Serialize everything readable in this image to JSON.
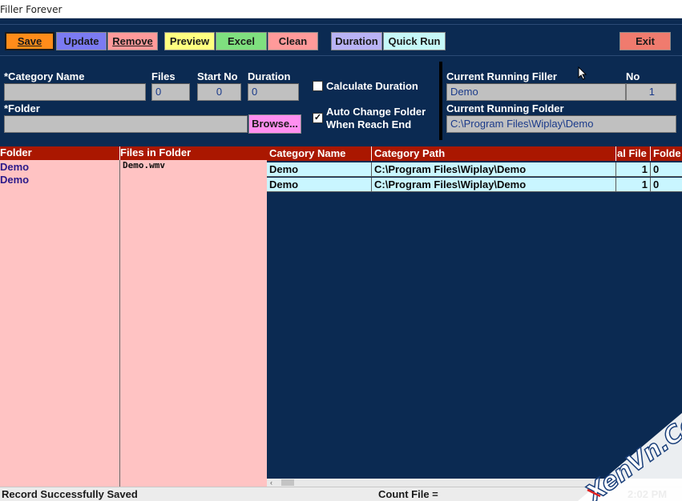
{
  "window": {
    "title": "Filler Forever"
  },
  "toolbar": {
    "save": {
      "label": "Save",
      "color": "#ff8c1a"
    },
    "update": {
      "label": "Update",
      "color": "#7b7bf2"
    },
    "remove": {
      "label": "Remove",
      "color": "#ff9a9a"
    },
    "preview": {
      "label": "Preview",
      "color": "#ffff80"
    },
    "excel": {
      "label": "Excel",
      "color": "#7fe07f"
    },
    "clean": {
      "label": "Clean",
      "color": "#ff9a9a"
    },
    "duration": {
      "label": "Duration",
      "color": "#b9b3f5"
    },
    "quick_run": {
      "label": "Quick Run",
      "color": "#c6f8f8"
    },
    "exit": {
      "label": "Exit",
      "color": "#f07b6e"
    }
  },
  "form": {
    "category_name_label": "*Category Name",
    "category_name_value": "",
    "files_label": "Files",
    "files_value": "0",
    "start_no_label": "Start No",
    "start_no_value": "0",
    "duration_label": "Duration",
    "duration_value": "0",
    "folder_label": "*Folder",
    "folder_value": "",
    "browse_label": "Browse...",
    "calculate_duration_label": "Calculate Duration",
    "calculate_duration_checked": false,
    "auto_change_label_line1": "Auto Change Folder",
    "auto_change_label_line2": "When Reach End",
    "auto_change_checked": true
  },
  "running": {
    "filler_label": "Current Running Filler",
    "no_label": "No",
    "filler_value": "Demo",
    "no_value": "1",
    "folder_label": "Current Running Folder",
    "folder_value": "C:\\Program Files\\Wiplay\\Demo"
  },
  "left_grid": {
    "headers": {
      "folder": "Folder",
      "files": "Files in Folder"
    },
    "folders": [
      "Demo",
      "Demo"
    ],
    "files": [
      "Demo.wmv"
    ]
  },
  "right_grid": {
    "headers": [
      "Category Name",
      "Category Path",
      "al File",
      "Folde"
    ],
    "rows": [
      [
        "Demo",
        "C:\\Program Files\\Wiplay\\Demo",
        "1",
        "0"
      ],
      [
        "Demo",
        "C:\\Program Files\\Wiplay\\Demo",
        "1",
        "0"
      ]
    ]
  },
  "status": {
    "message": "Record Successfully Saved",
    "count_file": "Count File =",
    "time": "2:02 PM"
  },
  "watermark": {
    "text": "XenVn.Com"
  }
}
